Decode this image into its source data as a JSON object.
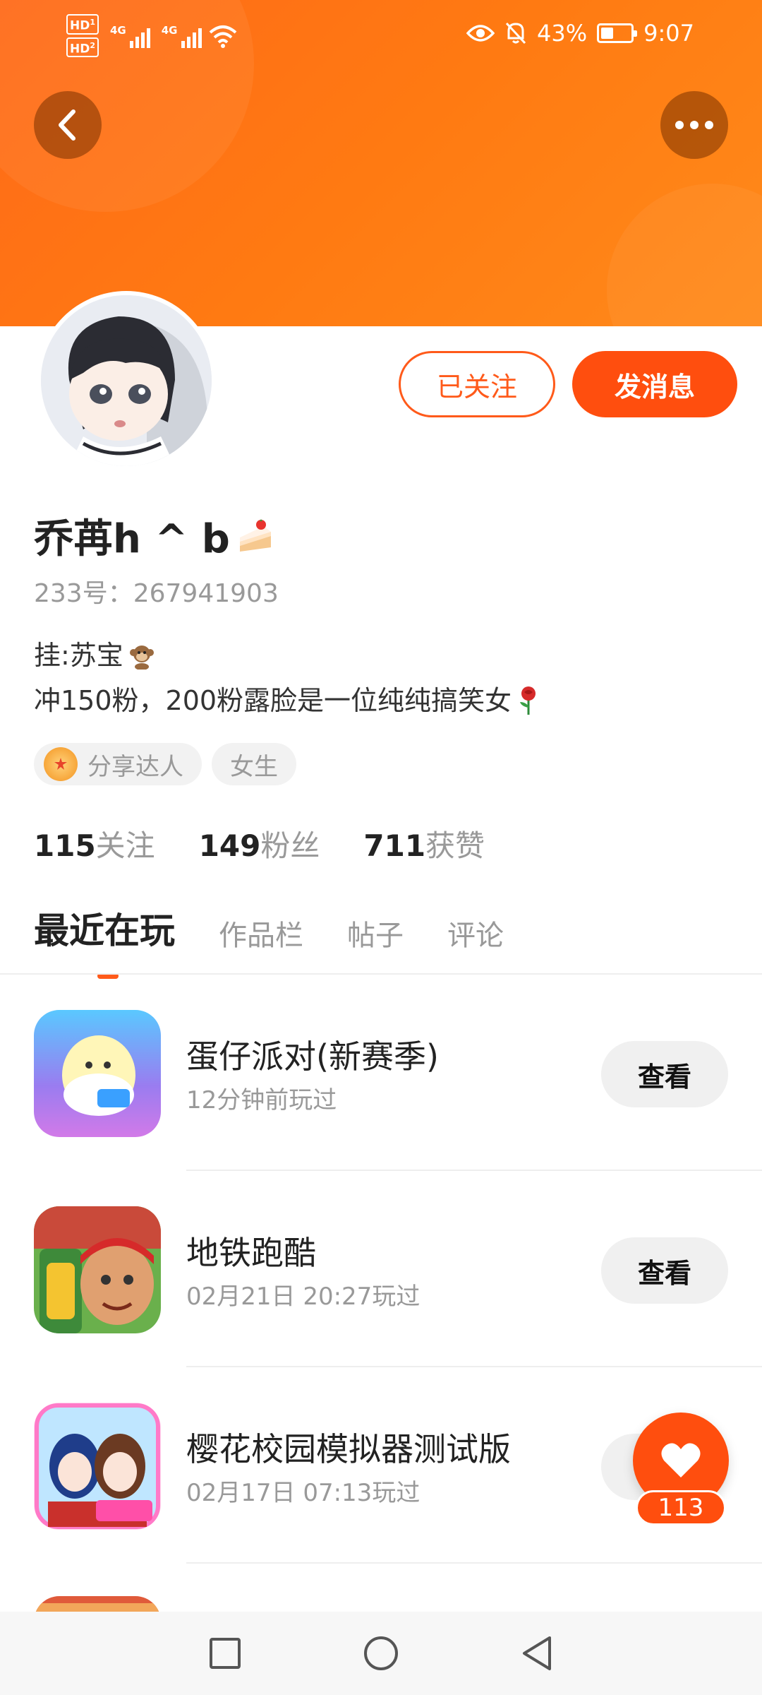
{
  "status_bar": {
    "hd1": "HD",
    "hd1_sub": "1",
    "hd2": "HD",
    "hd2_sub": "2",
    "net1": "4G",
    "net2": "4G",
    "battery": "43%",
    "battery_level": 0.43,
    "time": "9:07"
  },
  "header": {
    "back_icon": "chevron-left-icon",
    "more_icon": "more-dots-icon"
  },
  "profile": {
    "follow_label": "已关注",
    "message_label": "发消息",
    "name": "乔苒h ^ b",
    "uid": "233号：267941903",
    "bio_line1": "挂:苏宝",
    "bio_line2": "冲150粉，200粉露脸是一位纯纯搞笑女"
  },
  "tags": [
    {
      "label": "分享达人"
    },
    {
      "label": "女生"
    }
  ],
  "stats": [
    {
      "value": "115",
      "label": "关注"
    },
    {
      "value": "149",
      "label": "粉丝"
    },
    {
      "value": "711",
      "label": "获赞"
    }
  ],
  "tabs": [
    {
      "label": "最近在玩"
    },
    {
      "label": "作品栏"
    },
    {
      "label": "帖子"
    },
    {
      "label": "评论"
    }
  ],
  "games": [
    {
      "title": "蛋仔派对(新赛季)",
      "time": "12分钟前玩过",
      "button": "查看"
    },
    {
      "title": "地铁跑酷",
      "time": "02月21日 20:27玩过",
      "button": "查看"
    },
    {
      "title": "樱花校园模拟器测试版",
      "time": "02月17日 07:13玩过",
      "button": "查看"
    }
  ],
  "like": {
    "count": "113"
  },
  "colors": {
    "accent": "#ff4e0e",
    "banner": "#ff7a12"
  }
}
